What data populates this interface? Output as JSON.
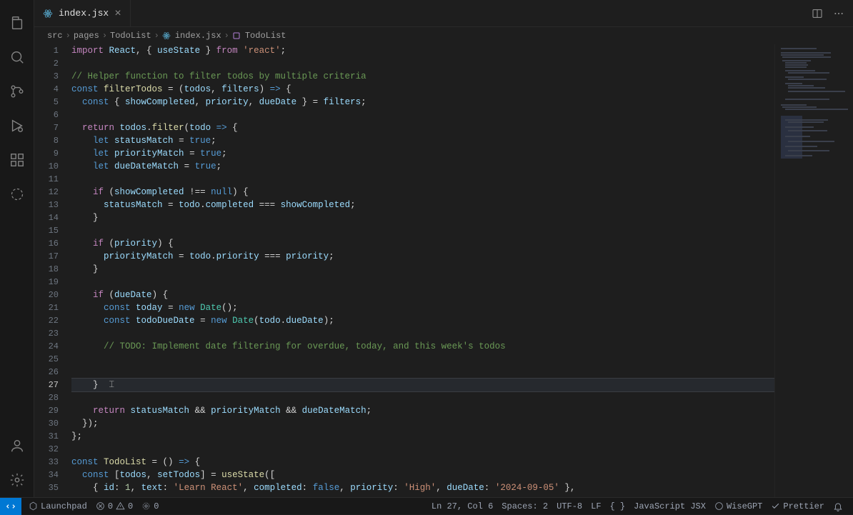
{
  "tab": {
    "filename": "index.jsx"
  },
  "breadcrumbs": {
    "parts": [
      "src",
      "pages",
      "TodoList",
      "index.jsx",
      "TodoList"
    ]
  },
  "code": {
    "lines": [
      {
        "n": 1,
        "seg": [
          [
            "k",
            "import"
          ],
          [
            "p",
            " "
          ],
          [
            "v",
            "React"
          ],
          [
            "p",
            ", { "
          ],
          [
            "v",
            "useState"
          ],
          [
            "p",
            " } "
          ],
          [
            "k",
            "from"
          ],
          [
            "p",
            " "
          ],
          [
            "s",
            "'react'"
          ],
          [
            "p",
            ";"
          ]
        ]
      },
      {
        "n": 2,
        "seg": []
      },
      {
        "n": 3,
        "seg": [
          [
            "c",
            "// Helper function to filter todos by multiple criteria"
          ]
        ]
      },
      {
        "n": 4,
        "seg": [
          [
            "kb",
            "const"
          ],
          [
            "p",
            " "
          ],
          [
            "fn",
            "filterTodos"
          ],
          [
            "p",
            " = ("
          ],
          [
            "v",
            "todos"
          ],
          [
            "p",
            ", "
          ],
          [
            "v",
            "filters"
          ],
          [
            "p",
            ") "
          ],
          [
            "kb",
            "=>"
          ],
          [
            "p",
            " {"
          ]
        ]
      },
      {
        "n": 5,
        "seg": [
          [
            "p",
            "  "
          ],
          [
            "kb",
            "const"
          ],
          [
            "p",
            " { "
          ],
          [
            "v",
            "showCompleted"
          ],
          [
            "p",
            ", "
          ],
          [
            "v",
            "priority"
          ],
          [
            "p",
            ", "
          ],
          [
            "v",
            "dueDate"
          ],
          [
            "p",
            " } = "
          ],
          [
            "v",
            "filters"
          ],
          [
            "p",
            ";"
          ]
        ]
      },
      {
        "n": 6,
        "seg": []
      },
      {
        "n": 7,
        "seg": [
          [
            "p",
            "  "
          ],
          [
            "k",
            "return"
          ],
          [
            "p",
            " "
          ],
          [
            "v",
            "todos"
          ],
          [
            "p",
            "."
          ],
          [
            "fn",
            "filter"
          ],
          [
            "p",
            "("
          ],
          [
            "v",
            "todo"
          ],
          [
            "p",
            " "
          ],
          [
            "kb",
            "=>"
          ],
          [
            "p",
            " {"
          ]
        ]
      },
      {
        "n": 8,
        "seg": [
          [
            "p",
            "    "
          ],
          [
            "kb",
            "let"
          ],
          [
            "p",
            " "
          ],
          [
            "v",
            "statusMatch"
          ],
          [
            "p",
            " = "
          ],
          [
            "b",
            "true"
          ],
          [
            "p",
            ";"
          ]
        ]
      },
      {
        "n": 9,
        "seg": [
          [
            "p",
            "    "
          ],
          [
            "kb",
            "let"
          ],
          [
            "p",
            " "
          ],
          [
            "v",
            "priorityMatch"
          ],
          [
            "p",
            " = "
          ],
          [
            "b",
            "true"
          ],
          [
            "p",
            ";"
          ]
        ]
      },
      {
        "n": 10,
        "seg": [
          [
            "p",
            "    "
          ],
          [
            "kb",
            "let"
          ],
          [
            "p",
            " "
          ],
          [
            "v",
            "dueDateMatch"
          ],
          [
            "p",
            " = "
          ],
          [
            "b",
            "true"
          ],
          [
            "p",
            ";"
          ]
        ]
      },
      {
        "n": 11,
        "seg": []
      },
      {
        "n": 12,
        "seg": [
          [
            "p",
            "    "
          ],
          [
            "k",
            "if"
          ],
          [
            "p",
            " ("
          ],
          [
            "v",
            "showCompleted"
          ],
          [
            "p",
            " !== "
          ],
          [
            "b",
            "null"
          ],
          [
            "p",
            ") {"
          ]
        ]
      },
      {
        "n": 13,
        "seg": [
          [
            "p",
            "      "
          ],
          [
            "v",
            "statusMatch"
          ],
          [
            "p",
            " = "
          ],
          [
            "v",
            "todo"
          ],
          [
            "p",
            "."
          ],
          [
            "v",
            "completed"
          ],
          [
            "p",
            " === "
          ],
          [
            "v",
            "showCompleted"
          ],
          [
            "p",
            ";"
          ]
        ]
      },
      {
        "n": 14,
        "seg": [
          [
            "p",
            "    }"
          ]
        ]
      },
      {
        "n": 15,
        "seg": []
      },
      {
        "n": 16,
        "seg": [
          [
            "p",
            "    "
          ],
          [
            "k",
            "if"
          ],
          [
            "p",
            " ("
          ],
          [
            "v",
            "priority"
          ],
          [
            "p",
            ") {"
          ]
        ]
      },
      {
        "n": 17,
        "seg": [
          [
            "p",
            "      "
          ],
          [
            "v",
            "priorityMatch"
          ],
          [
            "p",
            " = "
          ],
          [
            "v",
            "todo"
          ],
          [
            "p",
            "."
          ],
          [
            "v",
            "priority"
          ],
          [
            "p",
            " === "
          ],
          [
            "v",
            "priority"
          ],
          [
            "p",
            ";"
          ]
        ]
      },
      {
        "n": 18,
        "seg": [
          [
            "p",
            "    }"
          ]
        ]
      },
      {
        "n": 19,
        "seg": []
      },
      {
        "n": 20,
        "seg": [
          [
            "p",
            "    "
          ],
          [
            "k",
            "if"
          ],
          [
            "p",
            " ("
          ],
          [
            "v",
            "dueDate"
          ],
          [
            "p",
            ") {"
          ]
        ]
      },
      {
        "n": 21,
        "seg": [
          [
            "p",
            "      "
          ],
          [
            "kb",
            "const"
          ],
          [
            "p",
            " "
          ],
          [
            "v",
            "today"
          ],
          [
            "p",
            " = "
          ],
          [
            "kb",
            "new"
          ],
          [
            "p",
            " "
          ],
          [
            "t",
            "Date"
          ],
          [
            "p",
            "();"
          ]
        ]
      },
      {
        "n": 22,
        "seg": [
          [
            "p",
            "      "
          ],
          [
            "kb",
            "const"
          ],
          [
            "p",
            " "
          ],
          [
            "v",
            "todoDueDate"
          ],
          [
            "p",
            " = "
          ],
          [
            "kb",
            "new"
          ],
          [
            "p",
            " "
          ],
          [
            "t",
            "Date"
          ],
          [
            "p",
            "("
          ],
          [
            "v",
            "todo"
          ],
          [
            "p",
            "."
          ],
          [
            "v",
            "dueDate"
          ],
          [
            "p",
            ");"
          ]
        ]
      },
      {
        "n": 23,
        "seg": []
      },
      {
        "n": 24,
        "seg": [
          [
            "p",
            "      "
          ],
          [
            "c",
            "// TODO: Implement date filtering for overdue, today, and this week's todos"
          ]
        ]
      },
      {
        "n": 25,
        "seg": []
      },
      {
        "n": 26,
        "seg": []
      },
      {
        "n": 27,
        "cur": true,
        "seg": [
          [
            "p",
            "    }"
          ],
          [
            "cursor",
            "  ⌶"
          ]
        ]
      },
      {
        "n": 28,
        "seg": []
      },
      {
        "n": 29,
        "seg": [
          [
            "p",
            "    "
          ],
          [
            "k",
            "return"
          ],
          [
            "p",
            " "
          ],
          [
            "v",
            "statusMatch"
          ],
          [
            "p",
            " && "
          ],
          [
            "v",
            "priorityMatch"
          ],
          [
            "p",
            " && "
          ],
          [
            "v",
            "dueDateMatch"
          ],
          [
            "p",
            ";"
          ]
        ]
      },
      {
        "n": 30,
        "seg": [
          [
            "p",
            "  });"
          ]
        ]
      },
      {
        "n": 31,
        "seg": [
          [
            "p",
            "};"
          ]
        ]
      },
      {
        "n": 32,
        "seg": []
      },
      {
        "n": 33,
        "seg": [
          [
            "kb",
            "const"
          ],
          [
            "p",
            " "
          ],
          [
            "fn",
            "TodoList"
          ],
          [
            "p",
            " = () "
          ],
          [
            "kb",
            "=>"
          ],
          [
            "p",
            " {"
          ]
        ]
      },
      {
        "n": 34,
        "seg": [
          [
            "p",
            "  "
          ],
          [
            "kb",
            "const"
          ],
          [
            "p",
            " ["
          ],
          [
            "v",
            "todos"
          ],
          [
            "p",
            ", "
          ],
          [
            "v",
            "setTodos"
          ],
          [
            "p",
            "] = "
          ],
          [
            "fn",
            "useState"
          ],
          [
            "p",
            "(["
          ]
        ]
      },
      {
        "n": 35,
        "seg": [
          [
            "p",
            "    { "
          ],
          [
            "v",
            "id"
          ],
          [
            "p",
            ": "
          ],
          [
            "n",
            "1"
          ],
          [
            "p",
            ", "
          ],
          [
            "v",
            "text"
          ],
          [
            "p",
            ": "
          ],
          [
            "s",
            "'Learn React'"
          ],
          [
            "p",
            ", "
          ],
          [
            "v",
            "completed"
          ],
          [
            "p",
            ": "
          ],
          [
            "b",
            "false"
          ],
          [
            "p",
            ", "
          ],
          [
            "v",
            "priority"
          ],
          [
            "p",
            ": "
          ],
          [
            "s",
            "'High'"
          ],
          [
            "p",
            ", "
          ],
          [
            "v",
            "dueDate"
          ],
          [
            "p",
            ": "
          ],
          [
            "s",
            "'2024-09-05'"
          ],
          [
            "p",
            " },"
          ]
        ]
      }
    ]
  },
  "status": {
    "launchpad": "Launchpad",
    "errors": "0",
    "warnings": "0",
    "hints": "0",
    "cursor": "Ln 27, Col 6",
    "spaces": "Spaces: 2",
    "encoding": "UTF-8",
    "eol": "LF",
    "braces": "{ }",
    "lang": "JavaScript JSX",
    "wisegpt": "WiseGPT",
    "prettier": "Prettier"
  }
}
